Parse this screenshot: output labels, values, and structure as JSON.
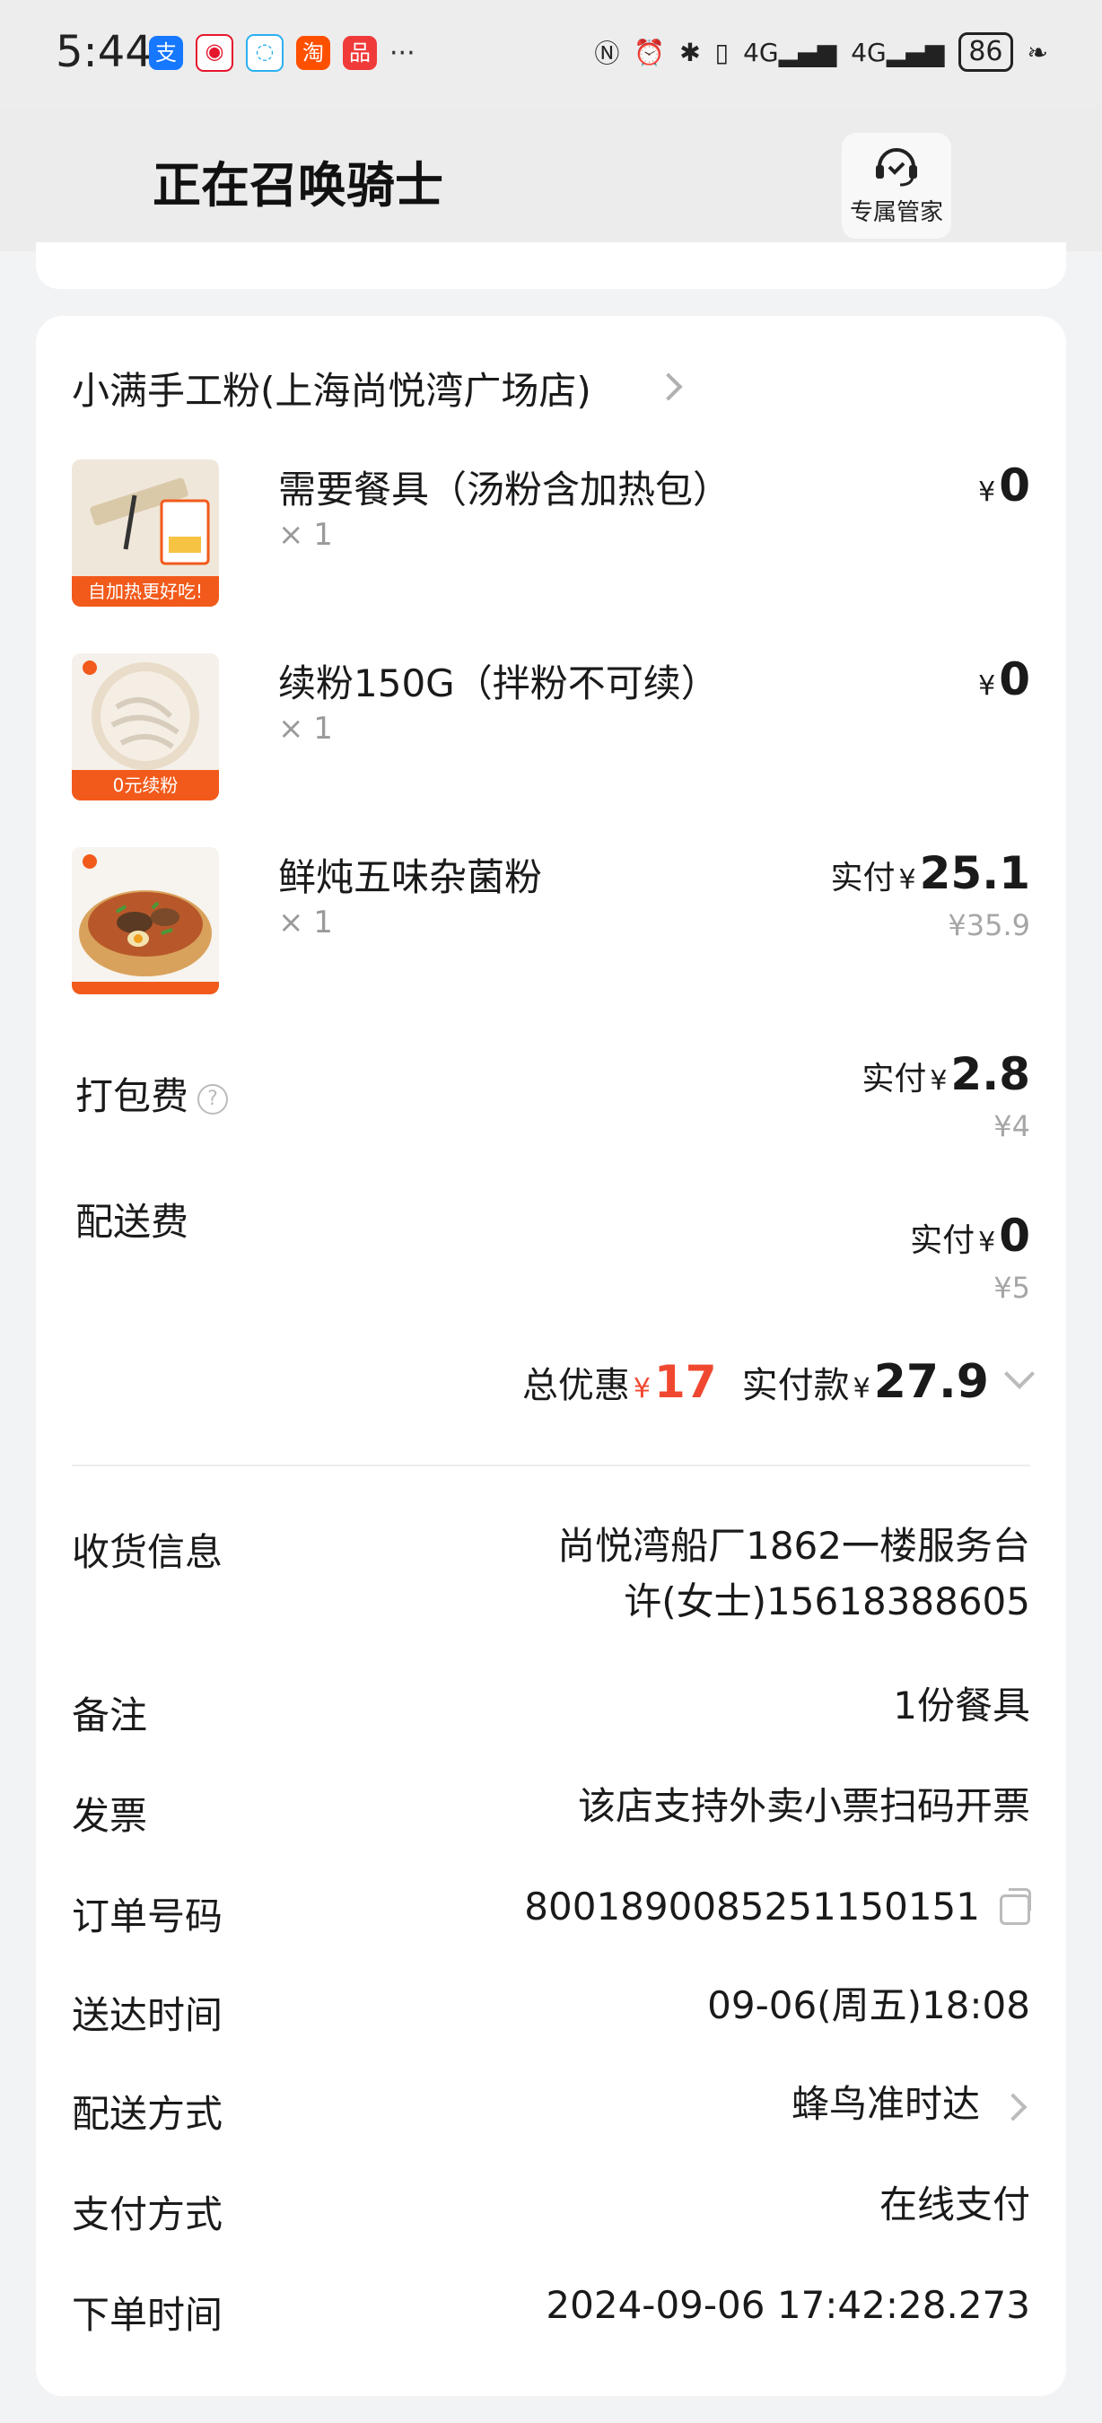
{
  "status_bar": {
    "time": "5:44",
    "more": "···",
    "network_1": "4G",
    "network_2": "4G",
    "battery": "86"
  },
  "header": {
    "title": "正在召唤骑士",
    "manager_label": "专属管家"
  },
  "order": {
    "store_name": "小满手工粉(上海尚悦湾广场店)",
    "items": [
      {
        "name": "需要餐具（汤粉含加热包）",
        "qty": "× 1",
        "currency": "¥",
        "price": "0",
        "thumb_text": "自加热更好吃!"
      },
      {
        "name": "续粉150G（拌粉不可续）",
        "qty": "× 1",
        "currency": "¥",
        "price": "0",
        "thumb_text": "0元续粉"
      },
      {
        "name": "鲜炖五味杂菌粉",
        "qty": "× 1",
        "paid_label": "实付",
        "currency": "¥",
        "price": "25.1",
        "original_price": "¥35.9"
      }
    ],
    "packing_fee": {
      "label": "打包费",
      "paid_label": "实付",
      "currency": "¥",
      "price": "2.8",
      "original": "¥4"
    },
    "delivery_fee": {
      "label": "配送费",
      "paid_label": "实付",
      "currency": "¥",
      "price": "0",
      "original": "¥5"
    },
    "totals": {
      "discount_label": "总优惠",
      "discount_currency": "¥",
      "discount_value": "17",
      "paid_label": "实付款",
      "paid_currency": "¥",
      "paid_value": "27.9"
    }
  },
  "info": {
    "receiver": {
      "label": "收货信息",
      "line1": "尚悦湾船厂1862一楼服务台",
      "line2": "许(女士)15618388605"
    },
    "note": {
      "label": "备注",
      "value": "1份餐具"
    },
    "invoice": {
      "label": "发票",
      "value": "该店支持外卖小票扫码开票"
    },
    "order_no": {
      "label": "订单号码",
      "value": "8001890085251150151"
    },
    "delivery_time": {
      "label": "送达时间",
      "value": "09-06(周五)18:08"
    },
    "delivery_method": {
      "label": "配送方式",
      "value": "蜂鸟准时达"
    },
    "payment": {
      "label": "支付方式",
      "value": "在线支付"
    },
    "order_time": {
      "label": "下单时间",
      "value": "2024-09-06 17:42:28.273"
    }
  },
  "colors": {
    "accent_red": "#f04830",
    "thumb_orange": "#f25a1b"
  }
}
